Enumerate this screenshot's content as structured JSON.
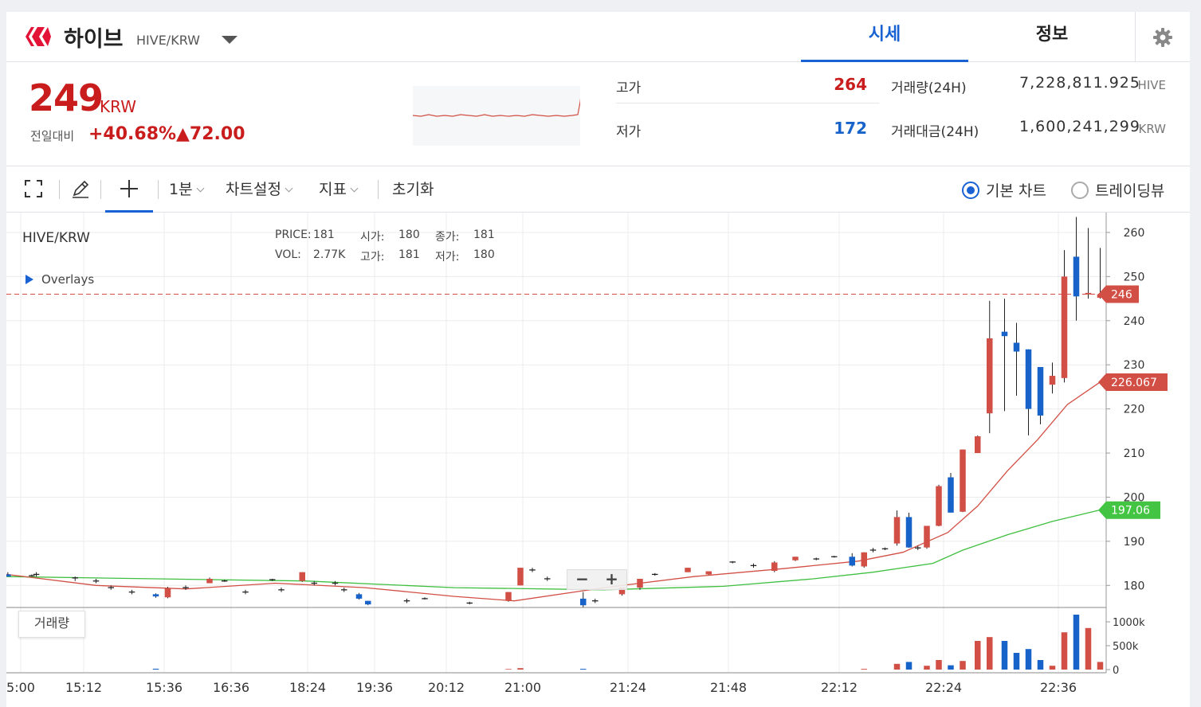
{
  "header": {
    "coin_name": "하이브",
    "pair": "HIVE/KRW",
    "tabs": [
      {
        "label": "시세",
        "active": true
      },
      {
        "label": "정보",
        "active": false
      }
    ]
  },
  "ticker": {
    "price": "249",
    "unit": "KRW",
    "change_label": "전일대비",
    "change_rate": "+40.68%",
    "change_amount": "▲72.00",
    "high_label": "고가",
    "high_value": "264",
    "low_label": "저가",
    "low_value": "172",
    "volume_label": "거래량(24H)",
    "volume_value": "7,228,811.925",
    "volume_unit": "HIVE",
    "amount_label": "거래대금(24H)",
    "amount_value": "1,600,241,299",
    "amount_unit": "KRW"
  },
  "toolbar": {
    "interval": "1분",
    "chart_settings": "차트설정",
    "indicators": "지표",
    "reset": "초기화",
    "basic_chart": "기본 차트",
    "tradingview": "트레이딩뷰"
  },
  "chart_info": {
    "symbol": "HIVE/KRW",
    "price_label": "PRICE:",
    "price": "181",
    "open_label": "시가:",
    "open": "180",
    "close_label": "종가:",
    "close": "181",
    "vol_label": "VOL:",
    "vol": "2.77K",
    "high_label": "고가:",
    "high": "181",
    "low_label": "저가:",
    "low": "180",
    "overlays": "Overlays",
    "volume_panel": "거래량",
    "zoom_out": "−",
    "zoom_in": "+"
  },
  "colors": {
    "up": "#d24f45",
    "down": "#1763c9",
    "accent": "#1862d4",
    "ma_short": "#d24f45",
    "ma_long": "#3fbf3f"
  },
  "chart_data": {
    "type": "candlestick",
    "x_ticks": [
      "5:00",
      "15:12",
      "15:36",
      "16:36",
      "18:24",
      "19:36",
      "20:12",
      "21:00",
      "21:24",
      "21:48",
      "22:12",
      "22:24",
      "22:36"
    ],
    "y_ticks": [
      180,
      190,
      200,
      210,
      220,
      230,
      240,
      250,
      260
    ],
    "ylim": [
      175,
      264.5
    ],
    "last_price": "246",
    "ma_short_label": "226.067",
    "ma_long_label": "197.06",
    "vol_ticks": [
      "1000k",
      "500k",
      "0"
    ],
    "candles": [
      {
        "x": 0.5,
        "o": 182.5,
        "c": 182,
        "h": 183,
        "l": 182,
        "v": 0
      },
      {
        "x": 8.5,
        "o": 182.2,
        "c": 182.2,
        "h": 182.5,
        "l": 182,
        "v": 0
      },
      {
        "x": 10,
        "o": 182.5,
        "c": 182.5,
        "h": 183,
        "l": 182,
        "v": 0
      },
      {
        "x": 23,
        "o": 181.7,
        "c": 181.7,
        "h": 182,
        "l": 181,
        "v": 0
      },
      {
        "x": 30,
        "o": 181,
        "c": 181,
        "h": 181.5,
        "l": 180.5,
        "v": 0
      },
      {
        "x": 35,
        "o": 179.5,
        "c": 179.5,
        "h": 180,
        "l": 179,
        "v": 0
      },
      {
        "x": 42,
        "o": 178.5,
        "c": 178.5,
        "h": 179,
        "l": 178,
        "v": 0
      },
      {
        "x": 50,
        "o": 178,
        "c": 177.5,
        "h": 178.2,
        "l": 177.2,
        "v": 18000
      },
      {
        "x": 54,
        "o": 177.3,
        "c": 179.4,
        "h": 179.7,
        "l": 177.1,
        "v": 0
      },
      {
        "x": 60,
        "o": 179.5,
        "c": 179.5,
        "h": 180,
        "l": 179,
        "v": 0
      },
      {
        "x": 68,
        "o": 180.5,
        "c": 181.5,
        "h": 181.8,
        "l": 180.5,
        "v": 0
      },
      {
        "x": 73,
        "o": 181,
        "c": 181,
        "h": 181.3,
        "l": 180.8,
        "v": 0
      },
      {
        "x": 80,
        "o": 178.5,
        "c": 178.5,
        "h": 179,
        "l": 178,
        "v": 0
      },
      {
        "x": 89,
        "o": 181.3,
        "c": 181.3,
        "h": 181.5,
        "l": 181,
        "v": 0
      },
      {
        "x": 92,
        "o": 179,
        "c": 179,
        "h": 179.5,
        "l": 178.5,
        "v": 0
      },
      {
        "x": 99,
        "o": 181,
        "c": 183,
        "h": 183,
        "l": 180.8,
        "v": 0
      },
      {
        "x": 103,
        "o": 180.5,
        "c": 180.5,
        "h": 181,
        "l": 180,
        "v": 0
      },
      {
        "x": 110,
        "o": 180.5,
        "c": 180.5,
        "h": 181,
        "l": 180,
        "v": 0
      },
      {
        "x": 113,
        "o": 179,
        "c": 179,
        "h": 179.5,
        "l": 178.5,
        "v": 0
      },
      {
        "x": 118,
        "o": 178,
        "c": 177,
        "h": 178.3,
        "l": 176.8,
        "v": 0
      },
      {
        "x": 121,
        "o": 176.5,
        "c": 175.7,
        "h": 176.5,
        "l": 175.5,
        "v": 0
      },
      {
        "x": 134,
        "o": 176.5,
        "c": 176.5,
        "h": 177,
        "l": 176,
        "v": 0
      },
      {
        "x": 140,
        "o": 177,
        "c": 177,
        "h": 177.3,
        "l": 176.8,
        "v": 0
      },
      {
        "x": 155,
        "o": 176,
        "c": 176,
        "h": 176.3,
        "l": 175.7,
        "v": 0
      },
      {
        "x": 168,
        "o": 176.5,
        "c": 178.5,
        "h": 178.5,
        "l": 176.3,
        "v": 12000
      },
      {
        "x": 172,
        "o": 180,
        "c": 184,
        "h": 184,
        "l": 180,
        "v": 30000
      },
      {
        "x": 176,
        "o": 183.5,
        "c": 183.5,
        "h": 184,
        "l": 183,
        "v": 0
      },
      {
        "x": 181,
        "o": 181.5,
        "c": 181.5,
        "h": 182,
        "l": 181,
        "v": 0
      },
      {
        "x": 193,
        "o": 177,
        "c": 175.5,
        "h": 178.5,
        "l": 175,
        "v": 16000
      },
      {
        "x": 197,
        "o": 176.5,
        "c": 176.5,
        "h": 177,
        "l": 176,
        "v": 0
      },
      {
        "x": 206,
        "o": 178,
        "c": 179.5,
        "h": 179.5,
        "l": 177.7,
        "v": 0
      },
      {
        "x": 212,
        "o": 179.5,
        "c": 181.5,
        "h": 181.5,
        "l": 179,
        "v": 0
      },
      {
        "x": 217,
        "o": 182.5,
        "c": 182.5,
        "h": 182.8,
        "l": 182.2,
        "v": 0
      },
      {
        "x": 228,
        "o": 183,
        "c": 184,
        "h": 184,
        "l": 183,
        "v": 0
      },
      {
        "x": 235,
        "o": 182.5,
        "c": 183.2,
        "h": 183.2,
        "l": 182.4,
        "v": 0
      },
      {
        "x": 243,
        "o": 185.3,
        "c": 185.3,
        "h": 185.5,
        "l": 185,
        "v": 0
      },
      {
        "x": 250,
        "o": 184.5,
        "c": 184.5,
        "h": 185,
        "l": 184,
        "v": 0
      },
      {
        "x": 257,
        "o": 183.3,
        "c": 185.2,
        "h": 185.5,
        "l": 183,
        "v": 0
      },
      {
        "x": 264,
        "o": 185.7,
        "c": 186.5,
        "h": 186.5,
        "l": 185.5,
        "v": 0
      },
      {
        "x": 271,
        "o": 186,
        "c": 186,
        "h": 186.3,
        "l": 185.7,
        "v": 0
      },
      {
        "x": 277,
        "o": 186.5,
        "c": 186.5,
        "h": 186.7,
        "l": 186.3,
        "v": 0
      },
      {
        "x": 283,
        "o": 186.5,
        "c": 184.5,
        "h": 187.3,
        "l": 184.3,
        "v": 0
      },
      {
        "x": 287,
        "o": 184.3,
        "c": 187.5,
        "h": 187.5,
        "l": 184,
        "v": 15000
      },
      {
        "x": 290,
        "o": 188,
        "c": 188,
        "h": 188.5,
        "l": 187.5,
        "v": 0
      },
      {
        "x": 294,
        "o": 188.3,
        "c": 188.3,
        "h": 188.6,
        "l": 188,
        "v": 0
      },
      {
        "x": 298,
        "o": 189.5,
        "c": 195.5,
        "h": 197,
        "l": 189,
        "v": 120000
      },
      {
        "x": 302,
        "o": 195.5,
        "c": 188.6,
        "h": 196.5,
        "l": 188.5,
        "v": 160000
      },
      {
        "x": 305,
        "o": 188.5,
        "c": 188.5,
        "h": 189,
        "l": 188,
        "v": 0
      },
      {
        "x": 308,
        "o": 188.6,
        "c": 193.5,
        "h": 193.5,
        "l": 188.3,
        "v": 80000
      },
      {
        "x": 312,
        "o": 193.5,
        "c": 202.5,
        "h": 202.8,
        "l": 193.4,
        "v": 200000
      },
      {
        "x": 316,
        "o": 204.5,
        "c": 196.5,
        "h": 205.5,
        "l": 196.5,
        "v": 90000
      },
      {
        "x": 320,
        "o": 196.7,
        "c": 210.8,
        "h": 210.8,
        "l": 196.6,
        "v": 180000
      },
      {
        "x": 325,
        "o": 210,
        "c": 213.8,
        "h": 214,
        "l": 210,
        "v": 600000
      },
      {
        "x": 329,
        "o": 219,
        "c": 236,
        "h": 244.5,
        "l": 214.5,
        "v": 680000
      },
      {
        "x": 334,
        "o": 237.5,
        "c": 236.5,
        "h": 245,
        "l": 219.5,
        "v": 600000
      },
      {
        "x": 338,
        "o": 235,
        "c": 233,
        "h": 239.5,
        "l": 223,
        "v": 350000
      },
      {
        "x": 342,
        "o": 233.5,
        "c": 220,
        "h": 233.5,
        "l": 214,
        "v": 430000
      },
      {
        "x": 346,
        "o": 229.5,
        "c": 218.5,
        "h": 229.5,
        "l": 216.5,
        "v": 200000
      },
      {
        "x": 350,
        "o": 225.5,
        "c": 227.5,
        "h": 230.5,
        "l": 223.5,
        "v": 80000
      },
      {
        "x": 354,
        "o": 227,
        "c": 250,
        "h": 256,
        "l": 226,
        "v": 780000
      },
      {
        "x": 358,
        "o": 254.5,
        "c": 245.5,
        "h": 263.5,
        "l": 240,
        "v": 1150000
      },
      {
        "x": 362,
        "o": 246,
        "c": 246.3,
        "h": 261,
        "l": 245,
        "v": 870000
      },
      {
        "x": 366,
        "o": 245.2,
        "c": 246,
        "h": 256.5,
        "l": 245,
        "v": 160000
      }
    ],
    "ma_short": [
      [
        0,
        182.5
      ],
      [
        30,
        180
      ],
      [
        60,
        179.2
      ],
      [
        90,
        180.5
      ],
      [
        120,
        179.5
      ],
      [
        150,
        177.5
      ],
      [
        170,
        176.5
      ],
      [
        200,
        179.5
      ],
      [
        230,
        182
      ],
      [
        260,
        183.8
      ],
      [
        285,
        185.5
      ],
      [
        300,
        187.5
      ],
      [
        315,
        192
      ],
      [
        325,
        198
      ],
      [
        335,
        206
      ],
      [
        345,
        213
      ],
      [
        355,
        221
      ],
      [
        366,
        226.1
      ]
    ],
    "ma_long": [
      [
        0,
        182
      ],
      [
        50,
        181.5
      ],
      [
        100,
        181
      ],
      [
        150,
        179.5
      ],
      [
        200,
        179
      ],
      [
        240,
        179.8
      ],
      [
        270,
        181.5
      ],
      [
        290,
        183
      ],
      [
        310,
        185
      ],
      [
        320,
        188
      ],
      [
        335,
        191.5
      ],
      [
        350,
        194.5
      ],
      [
        366,
        197.1
      ]
    ]
  }
}
